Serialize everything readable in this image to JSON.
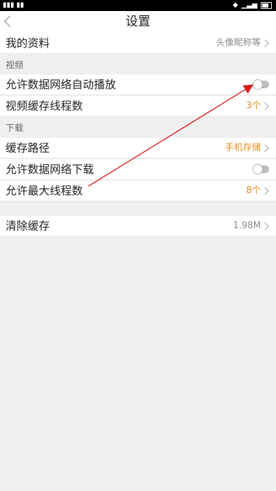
{
  "status_bar": {
    "left_glyphs": "𝐮𝐮𝐮 𝐮𝐮"
  },
  "header": {
    "title": "设置"
  },
  "profile": {
    "label": "我的资料",
    "value": "头像昵称等"
  },
  "video_section": {
    "title": "视频",
    "autoplay": {
      "label": "允许数据网络自动播放",
      "enabled": false
    },
    "cache_threads": {
      "label": "视频缓存线程数",
      "value": "3个"
    }
  },
  "download_section": {
    "title": "下载",
    "cache_path": {
      "label": "缓存路径",
      "value": "手机存储"
    },
    "allow_mobile_download": {
      "label": "允许数据网络下载",
      "enabled": false
    },
    "max_threads": {
      "label": "允许最大线程数",
      "value": "8个"
    }
  },
  "clear_cache": {
    "label": "清除缓存",
    "value": "1.98M"
  },
  "colors": {
    "accent": "#e98a1b",
    "arrow": "#d42020"
  }
}
